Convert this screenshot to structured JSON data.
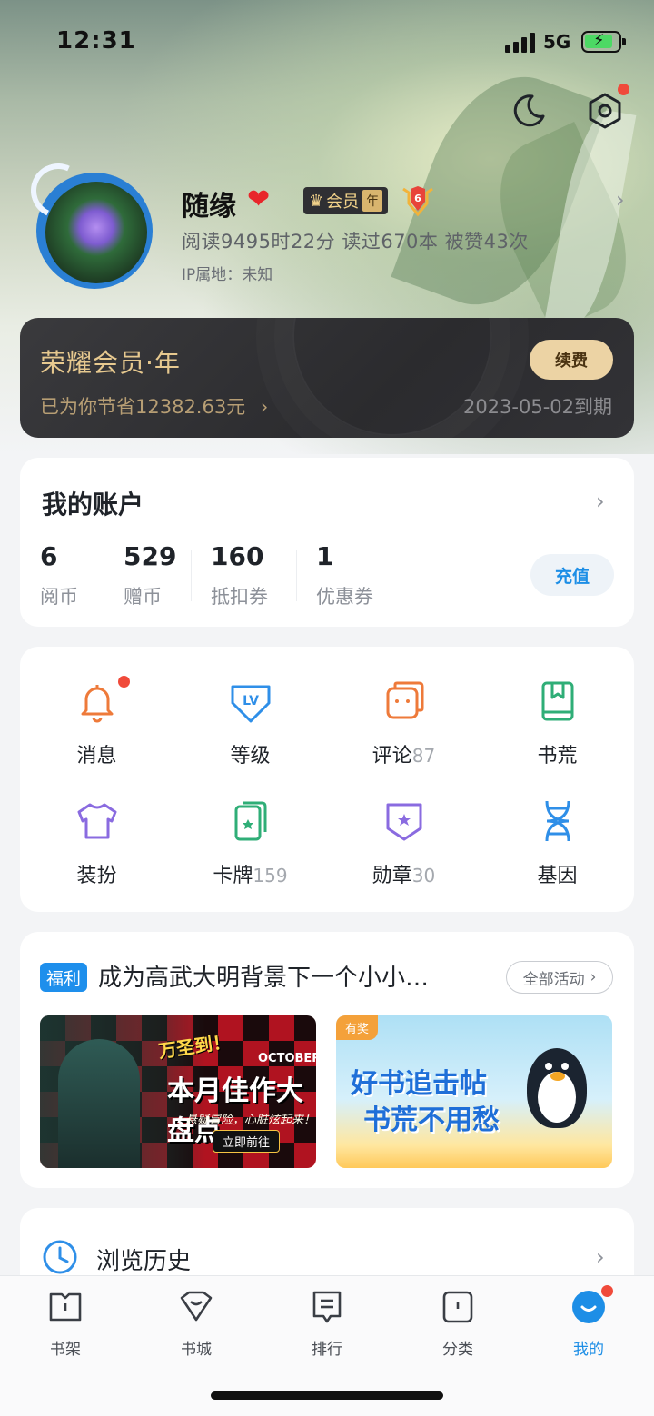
{
  "status": {
    "time": "12:31",
    "network": "5G"
  },
  "profile": {
    "nickname": "随缘",
    "vip_label": "会员",
    "vip_period": "年",
    "level": "6",
    "stats": "阅读9495时22分  读过670本  被赞43次",
    "ip": "IP属地：未知"
  },
  "vip_card": {
    "title": "荣耀会员·年",
    "saved": "已为你节省12382.63元",
    "renew": "续费",
    "expire": "2023-05-02到期"
  },
  "account": {
    "title": "我的账户",
    "items": [
      {
        "value": "6",
        "label": "阅币"
      },
      {
        "value": "529",
        "label": "赠币"
      },
      {
        "value": "160",
        "label": "抵扣券"
      },
      {
        "value": "1",
        "label": "优惠券"
      }
    ],
    "recharge": "充值"
  },
  "features": [
    {
      "label": "消息",
      "count": "",
      "icon": "bell-icon",
      "color": "#ee7a3a"
    },
    {
      "label": "等级",
      "count": "",
      "icon": "level-badge-icon",
      "color": "#2f8fe8"
    },
    {
      "label": "评论",
      "count": "87",
      "icon": "comment-icon",
      "color": "#ee7a3a"
    },
    {
      "label": "书荒",
      "count": "",
      "icon": "bookmark-book-icon",
      "color": "#2fae77"
    },
    {
      "label": "装扮",
      "count": "",
      "icon": "tshirt-icon",
      "color": "#8a6be0"
    },
    {
      "label": "卡牌",
      "count": "159",
      "icon": "cards-icon",
      "color": "#2fae77"
    },
    {
      "label": "勋章",
      "count": "30",
      "icon": "medal-icon",
      "color": "#8a6be0"
    },
    {
      "label": "基因",
      "count": "",
      "icon": "dna-icon",
      "color": "#2f8fe8"
    }
  ],
  "welfare": {
    "tag": "福利",
    "title": "成为高武大明背景下一个小小…",
    "all": "全部活动",
    "banner1": {
      "sub": "万圣到！",
      "main": "本月佳作大盘点",
      "eng": "OCTOBER",
      "tagline": "悬疑冒险，心脏炫起来！",
      "go": "立即前往"
    },
    "banner2": {
      "award": "有奖",
      "line1": "好书追击帖",
      "line2": "书荒不用愁"
    }
  },
  "history": {
    "label": "浏览历史"
  },
  "tabs": [
    {
      "label": "书架",
      "icon": "bookshelf-icon"
    },
    {
      "label": "书城",
      "icon": "bookstore-icon"
    },
    {
      "label": "排行",
      "icon": "ranking-icon"
    },
    {
      "label": "分类",
      "icon": "category-icon"
    },
    {
      "label": "我的",
      "icon": "profile-icon",
      "active": true
    }
  ],
  "colors": {
    "accent": "#1d8ee6",
    "gold": "#e7c98f",
    "badge_red": "#f04a3a"
  }
}
